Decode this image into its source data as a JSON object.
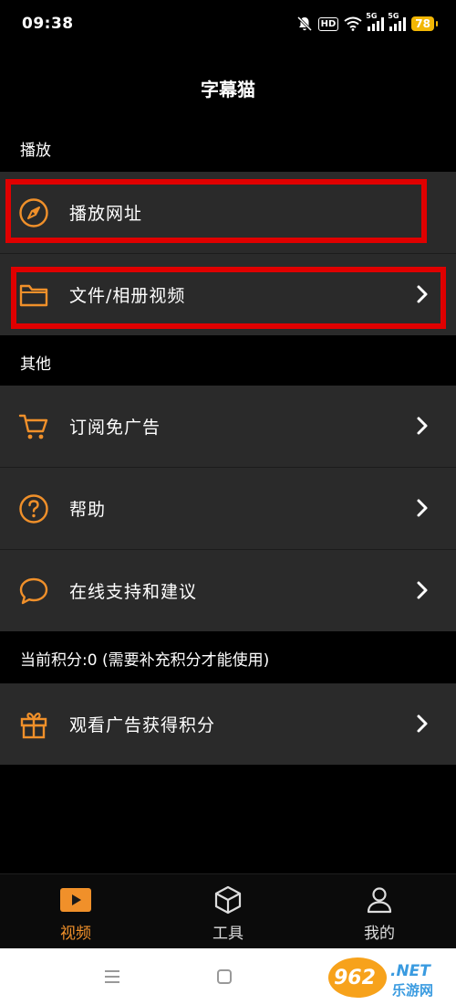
{
  "status_bar": {
    "time": "09:38",
    "hd_label": "HD",
    "signal1_tag": "5G",
    "signal2_tag": "5G",
    "battery": "78"
  },
  "header": {
    "title": "字幕猫"
  },
  "sections": {
    "play": "播放",
    "other": "其他",
    "points": "当前积分:0 (需要补充积分才能使用)"
  },
  "rows": {
    "play_url": {
      "label": "播放网址",
      "icon": "compass-icon"
    },
    "file_album_video": {
      "label": "文件/相册视频",
      "icon": "folder-icon"
    },
    "subscribe_no_ads": {
      "label": "订阅免广告",
      "icon": "cart-icon"
    },
    "help": {
      "label": "帮助",
      "icon": "question-icon"
    },
    "online_support": {
      "label": "在线支持和建议",
      "icon": "chat-bubble-icon"
    },
    "watch_ads_points": {
      "label": "观看广告获得积分",
      "icon": "gift-icon"
    }
  },
  "bottom_nav": {
    "video": "视频",
    "tools": "工具",
    "mine": "我的"
  },
  "watermark": {
    "text_main": "962.NET",
    "text_sub": "乐游网"
  },
  "colors": {
    "accent": "#f0902a",
    "row_bg": "#2a2a2a",
    "highlight": "#e00000",
    "battery": "#f2b705"
  }
}
